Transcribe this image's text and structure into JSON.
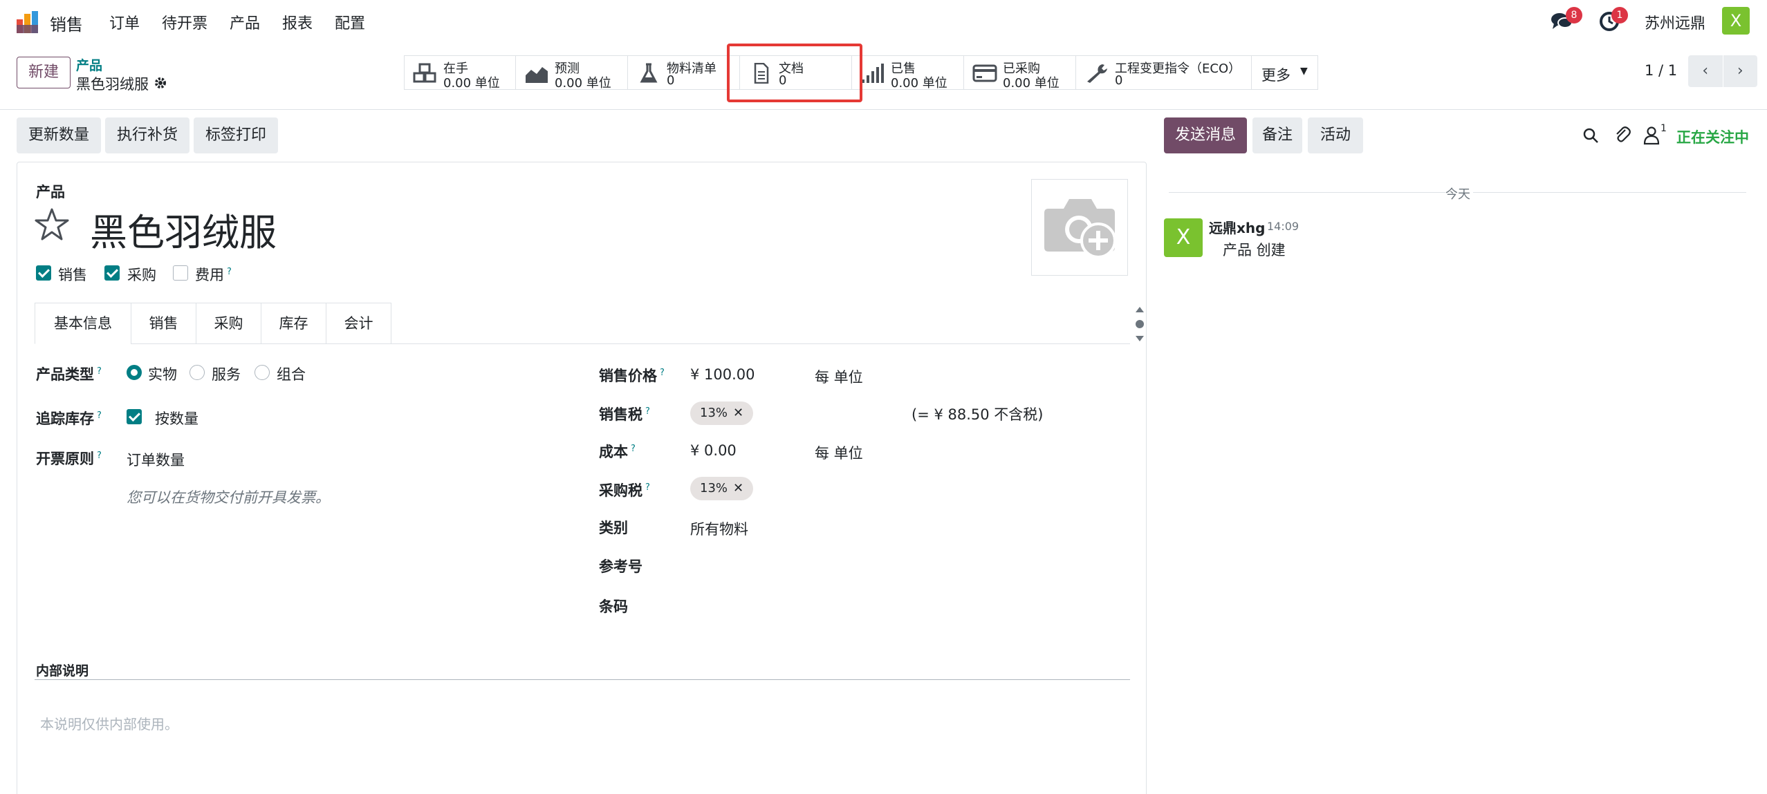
{
  "nav": {
    "app_name": "销售",
    "menu": [
      "订单",
      "待开票",
      "产品",
      "报表",
      "配置"
    ],
    "messages_badge": "8",
    "activity_badge": "1",
    "company": "苏州远鼎",
    "user_initial": "X"
  },
  "control": {
    "new_label": "新建",
    "breadcrumb_parent": "产品",
    "record_name": "黑色羽绒服",
    "pager": "1 / 1",
    "stats": [
      {
        "label": "在手",
        "value": "0.00 单位",
        "icon": "cubes-icon"
      },
      {
        "label": "预测",
        "value": "0.00 单位",
        "icon": "area-chart-icon"
      },
      {
        "label": "物料清单",
        "value": "0",
        "icon": "flask-icon"
      },
      {
        "label": "文档",
        "value": "0",
        "icon": "document-icon"
      },
      {
        "label": "已售",
        "value": "0.00 单位",
        "icon": "signal-icon"
      },
      {
        "label": "已采购",
        "value": "0.00 单位",
        "icon": "credit-card-icon"
      },
      {
        "label": "工程变更指令（ECO）",
        "value": "0",
        "icon": "wrench-icon"
      }
    ],
    "more_label": "更多"
  },
  "actions": [
    "更新数量",
    "执行补货",
    "标签打印"
  ],
  "form": {
    "section_label": "产品",
    "product_name": "黑色羽绒服",
    "checks": [
      {
        "label": "销售",
        "checked": true
      },
      {
        "label": "采购",
        "checked": true
      },
      {
        "label": "费用",
        "checked": false,
        "help": "?"
      }
    ],
    "tabs": [
      "基本信息",
      "销售",
      "采购",
      "库存",
      "会计"
    ],
    "left": {
      "product_type_label": "产品类型",
      "product_type_options": [
        "实物",
        "服务",
        "组合"
      ],
      "track_label": "追踪库存",
      "track_value": "按数量",
      "invoice_policy_label": "开票原则",
      "invoice_policy_value": "订单数量",
      "invoice_hint": "您可以在货物交付前开具发票。"
    },
    "right": {
      "sale_price_label": "销售价格",
      "sale_price_value": "¥ 100.00",
      "sale_price_unit": "每 单位",
      "sale_tax_label": "销售税",
      "sale_tax_tag": "13%",
      "sale_tax_note": "(= ¥ 88.50 不含税)",
      "cost_label": "成本",
      "cost_value": "¥ 0.00",
      "cost_unit": "每 单位",
      "purchase_tax_label": "采购税",
      "purchase_tax_tag": "13%",
      "category_label": "类别",
      "category_value": "所有物料",
      "ref_label": "参考号",
      "barcode_label": "条码"
    },
    "internal_note_label": "内部说明",
    "internal_note_placeholder": "本说明仅供内部使用。",
    "help_mark": "?"
  },
  "chatter": {
    "send_label": "发送消息",
    "note_label": "备注",
    "activity_label": "活动",
    "follower_count": "1",
    "following_label": "正在关注中",
    "date_divider": "今天",
    "message": {
      "author": "远鼎xhg",
      "time": "14:09",
      "body": "产品 创建",
      "avatar_initial": "X"
    }
  },
  "colors": {
    "primary": "#714b67",
    "accent": "#017e84",
    "highlight": "#e53935",
    "following": "#28a745"
  }
}
